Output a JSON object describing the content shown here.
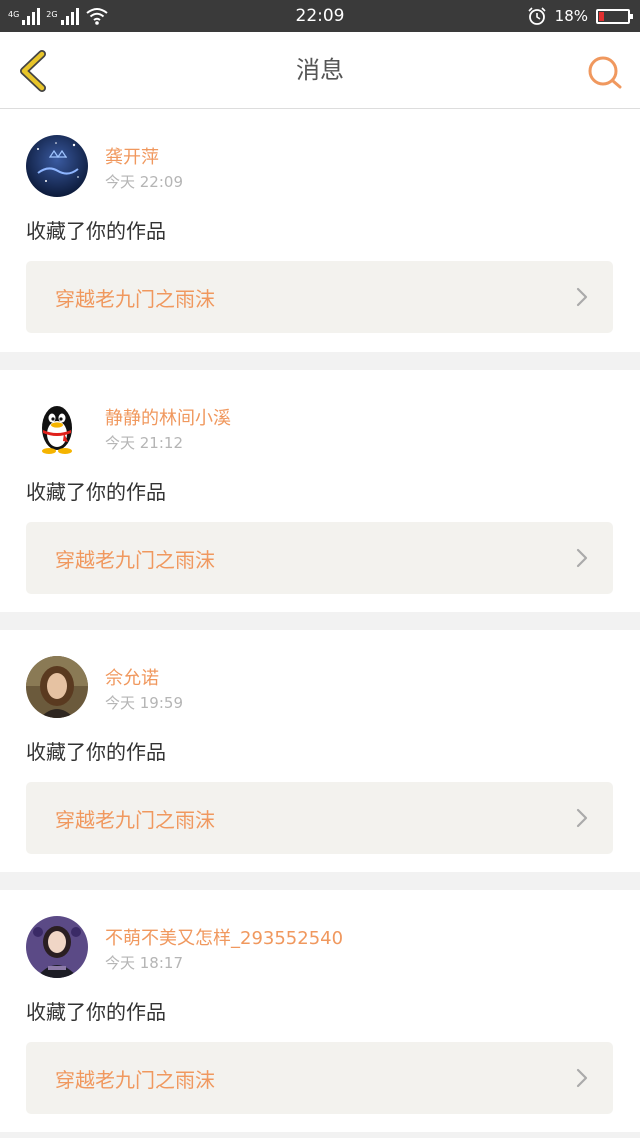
{
  "status_bar": {
    "network_1": "4G",
    "network_2": "2G",
    "time": "22:09",
    "battery_percent": "18%",
    "battery_level": 0.18,
    "icons": [
      "signal-icon",
      "wifi-icon",
      "alarm-icon",
      "battery-icon"
    ]
  },
  "nav": {
    "title": "消息",
    "back_icon": "chevron-left-icon",
    "search_icon": "search-icon"
  },
  "colors": {
    "accent": "#f0985e",
    "back_icon": "#e8c52a",
    "status_bar_bg": "#3a3a3a",
    "card_link_bg": "#f3f2ee"
  },
  "messages": [
    {
      "user": "龚开萍",
      "time": "今天 22:09",
      "action": "收藏了你的作品",
      "work_title": "穿越老九门之雨沫",
      "avatar": "night-sky-avatar"
    },
    {
      "user": "静静的林间小溪",
      "time": "今天 21:12",
      "action": "收藏了你的作品",
      "work_title": "穿越老九门之雨沫",
      "avatar": "qq-penguin-avatar"
    },
    {
      "user": "佘允诺",
      "time": "今天 19:59",
      "action": "收藏了你的作品",
      "work_title": "穿越老九门之雨沫",
      "avatar": "photo-avatar"
    },
    {
      "user": "不萌不美又怎样_293552540",
      "time": "今天 18:17",
      "action": "收藏了你的作品",
      "work_title": "穿越老九门之雨沫",
      "avatar": "photo-avatar"
    }
  ]
}
